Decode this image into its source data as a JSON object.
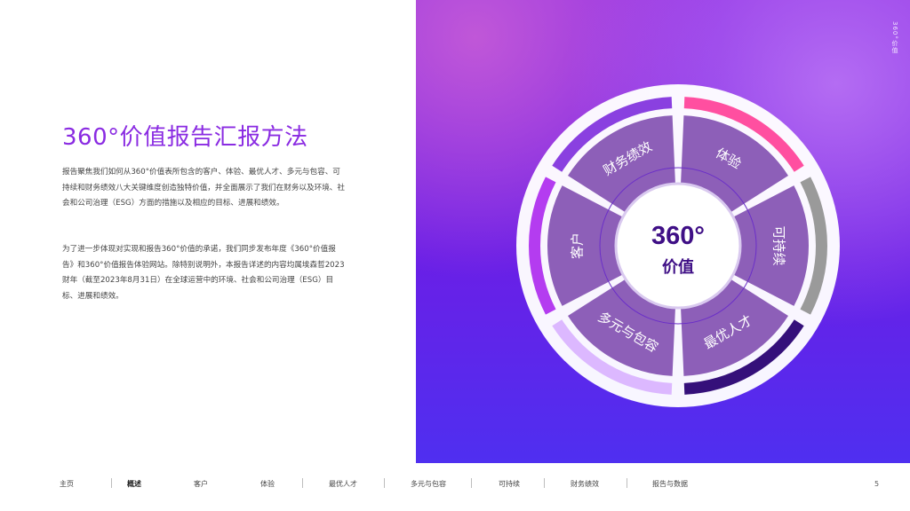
{
  "title": "360°价值报告汇报方法",
  "paragraph1": "报告聚焦我们如何从360°价值表所包含的客户、体验、最优人才、多元与包容、可持续和财务绩效八大关键维度创造独特价值，并全面展示了我们在财务以及环境、社会和公司治理（ESG）方面的措施以及相应的目标、进展和绩效。",
  "paragraph2": "为了进一步体现对实现和报告360°价值的承诺，我们同步发布年度《360°价值报告》和360°价值报告体验网站。除特别说明外，本报告详述的内容均属埃森哲2023财年（截至2023年8月31日）在全球运营中的环境、社会和公司治理（ESG）目标、进展和绩效。",
  "side_label": "360°价值",
  "wheel": {
    "center_top": "360°",
    "center_bottom": "价值",
    "segments": [
      "体验",
      "可持续",
      "最优人才",
      "多元与包容",
      "客户",
      "财务绩效"
    ],
    "ring_colors": [
      "#ff4fa0",
      "#9a9a9a",
      "#35107a",
      "#dcb8ff",
      "#b43cf0",
      "#8a40e0"
    ],
    "segment_color": "#8d5fb8"
  },
  "nav": {
    "items": [
      "主页",
      "概述",
      "客户",
      "体验",
      "最优人才",
      "多元与包容",
      "可持续",
      "财务绩效",
      "报告与数据"
    ],
    "active": "概述"
  },
  "page_number": "5"
}
